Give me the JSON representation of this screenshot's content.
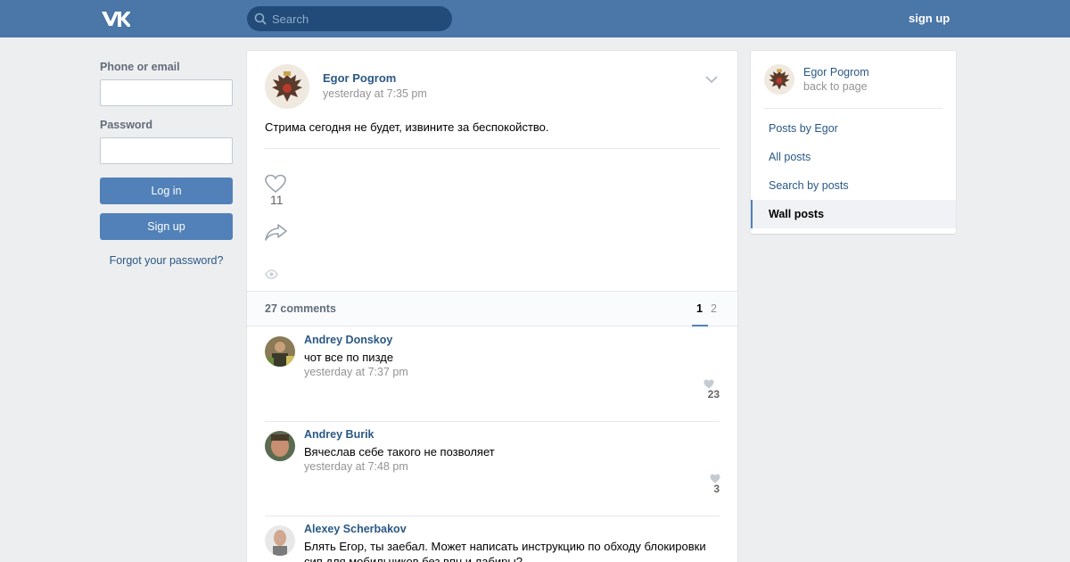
{
  "header": {
    "search_placeholder": "Search",
    "signup_label": "sign up"
  },
  "login": {
    "phone_label": "Phone or email",
    "password_label": "Password",
    "login_button": "Log in",
    "signup_button": "Sign up",
    "forgot_link": "Forgot your password?"
  },
  "post": {
    "author": "Egor Pogrom",
    "date": "yesterday at 7:35 pm",
    "text": "Стрима сегодня не будет, извините за беспокойство.",
    "likes": "11",
    "comments_count": "27 comments",
    "pages": [
      "1",
      "2"
    ],
    "comments": [
      {
        "author": "Andrey Donskoy",
        "text": "чот все по пизде",
        "date": "yesterday at 7:37 pm",
        "likes": "23"
      },
      {
        "author": "Andrey Burik",
        "text": "Вячеслав себе такого не позволяет",
        "date": "yesterday at 7:48 pm",
        "likes": "3"
      },
      {
        "author": "Alexey Scherbakov",
        "text": "Блять Егор, ты заебал. Может написать инструкцию по обходу блокировки сип для мобильчиков без впн и лабиры?"
      }
    ]
  },
  "sidebar": {
    "name": "Egor Pogrom",
    "sub": "back to page",
    "items": [
      {
        "label": "Posts by Egor"
      },
      {
        "label": "All posts"
      },
      {
        "label": "Search by posts"
      },
      {
        "label": "Wall posts"
      }
    ]
  },
  "colors": {
    "header": "#4a76a8",
    "button": "#5181b8",
    "link": "#2a5885"
  }
}
